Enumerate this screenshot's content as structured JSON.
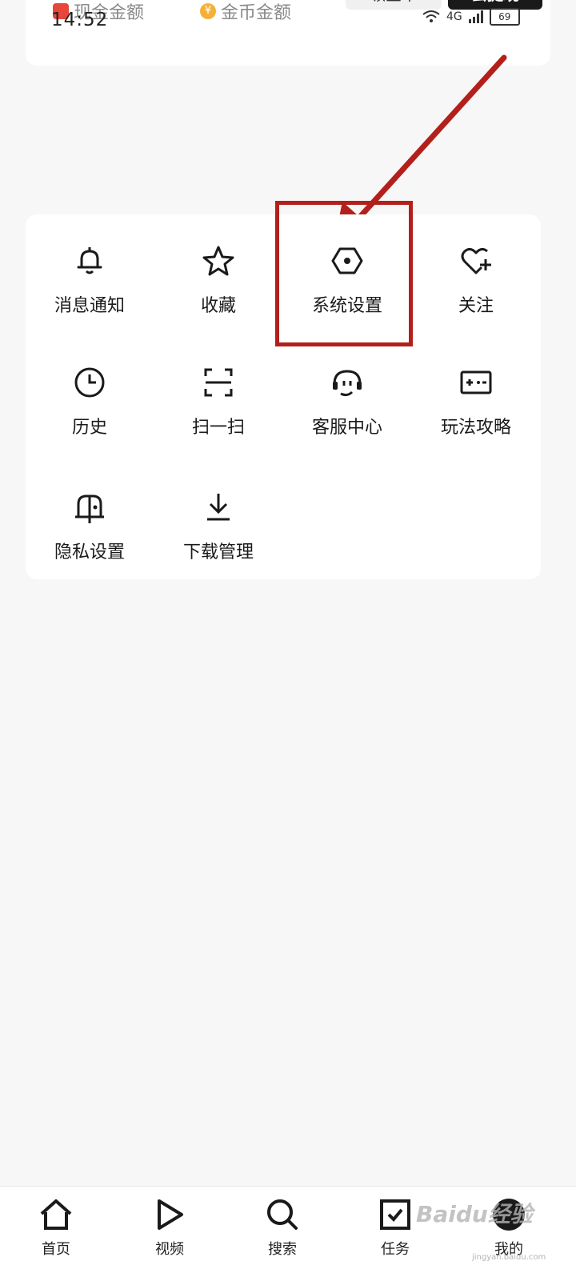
{
  "status_bar": {
    "time": "14:52",
    "network": "4G",
    "battery": "69"
  },
  "balance": {
    "cash_label": "现金金额",
    "coin_label": "金币金额",
    "coin_symbol": "¥",
    "get_coin_button": "领金币",
    "withdraw_button": "去提现"
  },
  "menu": {
    "items": [
      {
        "label": "消息通知",
        "icon": "bell-icon"
      },
      {
        "label": "收藏",
        "icon": "star-icon"
      },
      {
        "label": "系统设置",
        "icon": "settings-hexagon-icon"
      },
      {
        "label": "关注",
        "icon": "heart-plus-icon"
      },
      {
        "label": "历史",
        "icon": "clock-icon"
      },
      {
        "label": "扫一扫",
        "icon": "scan-icon"
      },
      {
        "label": "客服中心",
        "icon": "headset-icon"
      },
      {
        "label": "玩法攻略",
        "icon": "game-guide-icon"
      },
      {
        "label": "隐私设置",
        "icon": "privacy-mailbox-icon"
      },
      {
        "label": "下载管理",
        "icon": "download-icon"
      }
    ]
  },
  "annotation": {
    "highlight_color": "#b3201c"
  },
  "bottom_nav": {
    "items": [
      {
        "label": "首页",
        "icon": "home-icon"
      },
      {
        "label": "视频",
        "icon": "play-icon"
      },
      {
        "label": "搜索",
        "icon": "search-icon"
      },
      {
        "label": "任务",
        "icon": "task-check-icon"
      },
      {
        "label": "我的",
        "icon": "avatar"
      }
    ]
  },
  "watermark": {
    "text": "Baidu经验",
    "sub": "jingyan.baidu.com"
  }
}
